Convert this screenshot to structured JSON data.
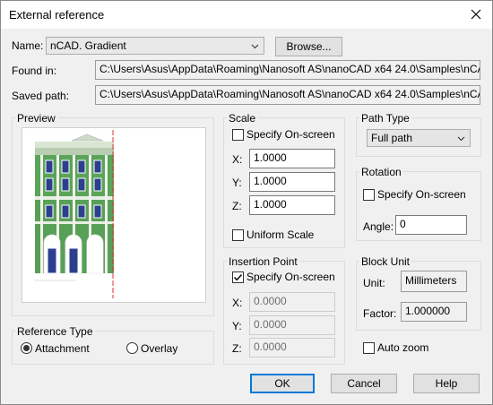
{
  "window": {
    "title": "External reference"
  },
  "name_row": {
    "label": "Name:",
    "value": "nCAD. Gradient",
    "browse_label": "Browse..."
  },
  "found_in": {
    "label": "Found in:",
    "value": "C:\\Users\\Asus\\AppData\\Roaming\\Nanosoft AS\\nanoCAD x64 24.0\\Samples\\nCAD. Gradient"
  },
  "saved_path": {
    "label": "Saved path:",
    "value": "C:\\Users\\Asus\\AppData\\Roaming\\Nanosoft AS\\nanoCAD x64 24.0\\Samples\\nCAD. Gradient"
  },
  "preview": {
    "label": "Preview"
  },
  "reference_type": {
    "label": "Reference Type",
    "attachment_label": "Attachment",
    "overlay_label": "Overlay",
    "selected": "Attachment"
  },
  "scale": {
    "label": "Scale",
    "specify_label": "Specify On-screen",
    "specify_checked": false,
    "x_label": "X:",
    "x_value": "1.0000",
    "y_label": "Y:",
    "y_value": "1.0000",
    "z_label": "Z:",
    "z_value": "1.0000",
    "uniform_label": "Uniform Scale",
    "uniform_checked": false
  },
  "insertion": {
    "label": "Insertion Point",
    "specify_label": "Specify On-screen",
    "specify_checked": true,
    "x_label": "X:",
    "x_value": "0.0000",
    "y_label": "Y:",
    "y_value": "0.0000",
    "z_label": "Z:",
    "z_value": "0.0000"
  },
  "path_type": {
    "label": "Path Type",
    "value": "Full path"
  },
  "rotation": {
    "label": "Rotation",
    "specify_label": "Specify On-screen",
    "specify_checked": false,
    "angle_label": "Angle:",
    "angle_value": "0"
  },
  "block_unit": {
    "label": "Block Unit",
    "unit_label": "Unit:",
    "unit_value": "Millimeters",
    "factor_label": "Factor:",
    "factor_value": "1.000000"
  },
  "auto_zoom": {
    "label": "Auto zoom",
    "checked": false
  },
  "buttons": {
    "ok": "OK",
    "cancel": "Cancel",
    "help": "Help"
  }
}
